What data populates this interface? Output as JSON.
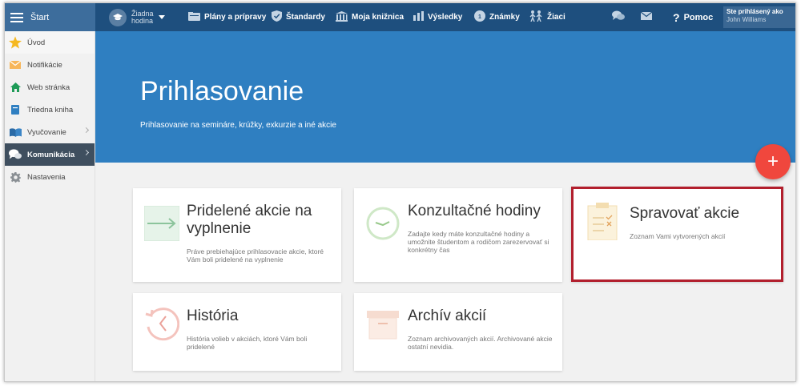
{
  "topbar": {
    "start": "Štart",
    "lesson_line1": "Žiadna",
    "lesson_line2": "hodina",
    "plans": "Plány a prípravy",
    "standards": "Štandardy",
    "library": "Moja knižnica",
    "results": "Výsledky",
    "grades": "Známky",
    "students": "Žiaci",
    "help": "Pomoc",
    "user_label": "Ste prihlásený ako",
    "user_name": "John Williams"
  },
  "sidebar": {
    "items": [
      {
        "label": "Úvod",
        "icon": "star-icon"
      },
      {
        "label": "Notifikácie",
        "icon": "envelope-icon"
      },
      {
        "label": "Web stránka",
        "icon": "home-icon"
      },
      {
        "label": "Triedna kniha",
        "icon": "book-icon"
      },
      {
        "label": "Vyučovanie",
        "icon": "open-book-icon"
      },
      {
        "label": "Komunikácia",
        "icon": "chat-icon"
      },
      {
        "label": "Nastavenia",
        "icon": "gear-icon"
      }
    ]
  },
  "hero": {
    "title": "Prihlasovanie",
    "subtitle": "Prihlasovanie na semináre, krúžky, exkurzie a iné akcie",
    "fab": "+"
  },
  "cards": [
    {
      "title": "Pridelené akcie na vyplnenie",
      "desc": "Práve prebiehajúce prihlasovacie akcie, ktoré Vám boli pridelené na vyplnenie"
    },
    {
      "title": "Konzultačné hodiny",
      "desc": "Zadajte kedy máte konzultačné hodiny a umožnite študentom a rodičom zarezervovať si konkrétny čas"
    },
    {
      "title": "Spravovať akcie",
      "desc": "Zoznam Vami vytvorených akcií"
    },
    {
      "title": "História",
      "desc": "História volieb v akciách, ktoré Vám boli pridelené"
    },
    {
      "title": "Archív akcií",
      "desc": "Zoznam archivovaných akcií. Archivované akcie ostatní nevidia."
    }
  ],
  "colors": {
    "topbar": "#1e4f7e",
    "hero": "#2f7fc1",
    "fab": "#f0473d",
    "active_sidebar": "#3f4f5f",
    "highlight": "#b21f2d"
  }
}
